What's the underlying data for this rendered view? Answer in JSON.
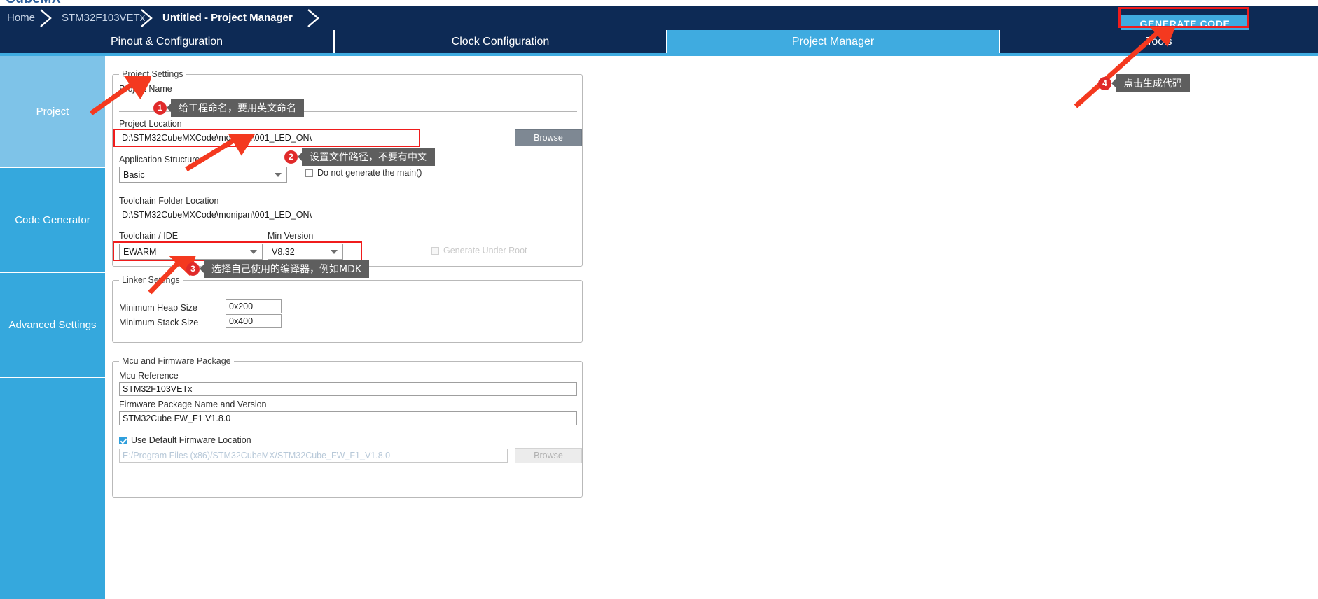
{
  "app": {
    "logo_text": "CubeMX"
  },
  "breadcrumb": {
    "items": [
      {
        "label": "Home",
        "active": false
      },
      {
        "label": "STM32F103VETx",
        "active": false
      },
      {
        "label": "Untitled - Project Manager",
        "active": true
      }
    ]
  },
  "header": {
    "generate_code_label": "GENERATE CODE"
  },
  "tabs": [
    {
      "label": "Pinout & Configuration",
      "selected": false
    },
    {
      "label": "Clock Configuration",
      "selected": false
    },
    {
      "label": "Project Manager",
      "selected": true
    },
    {
      "label": "Tools",
      "selected": false
    }
  ],
  "sidebar": {
    "items": [
      {
        "label": "Project",
        "selected": true
      },
      {
        "label": "Code Generator",
        "selected": false
      },
      {
        "label": "Advanced Settings",
        "selected": false
      },
      {
        "label": "",
        "selected": false
      }
    ]
  },
  "project_settings": {
    "group_title": "Project Settings",
    "project_name_label": "Project Name",
    "project_name_value": "",
    "project_name_placeholder": "",
    "project_location_label": "Project Location",
    "project_location_value": "D:\\STM32CubeMXCode\\monipan\\001_LED_ON\\",
    "browse_label": "Browse",
    "application_structure_label": "Application Structure",
    "application_structure_value": "Basic",
    "do_not_generate_main_label": "Do not generate the main()",
    "do_not_generate_main_checked": false,
    "toolchain_folder_label": "Toolchain Folder Location",
    "toolchain_folder_value": "D:\\STM32CubeMXCode\\monipan\\001_LED_ON\\",
    "toolchain_ide_label": "Toolchain / IDE",
    "toolchain_ide_value": "EWARM",
    "min_version_label": "Min Version",
    "min_version_value": "V8.32",
    "generate_under_root_label": "Generate Under Root",
    "generate_under_root_checked": false,
    "generate_under_root_disabled": true
  },
  "linker_settings": {
    "group_title": "Linker Settings",
    "min_heap_label": "Minimum Heap Size",
    "min_heap_value": "0x200",
    "min_stack_label": "Minimum Stack Size",
    "min_stack_value": "0x400"
  },
  "mcu_firmware": {
    "group_title": "Mcu and Firmware Package",
    "mcu_reference_label": "Mcu Reference",
    "mcu_reference_value": "STM32F103VETx",
    "firmware_package_label": "Firmware Package Name and Version",
    "firmware_package_value": "STM32Cube FW_F1 V1.8.0",
    "use_default_label": "Use Default Firmware Location",
    "use_default_checked": true,
    "firmware_path_value": "E:/Program Files (x86)/STM32CubeMX/STM32Cube_FW_F1_V1.8.0",
    "browse_label": "Browse"
  },
  "annotations": [
    {
      "number": "1",
      "text": "给工程命名，要用英文命名"
    },
    {
      "number": "2",
      "text": "设置文件路径，不要有中文"
    },
    {
      "number": "3",
      "text": "选择自己使用的编译器，例如MDK"
    },
    {
      "number": "4",
      "text": "点击生成代码"
    }
  ],
  "colors": {
    "brand_dark": "#0d2a55",
    "accent": "#3fabe0",
    "sidebar_selected": "#7ec3e8",
    "sidebar_normal": "#35a8dd",
    "highlight_red": "#f01c1c",
    "tooltip_bg": "#5e5e5e"
  }
}
